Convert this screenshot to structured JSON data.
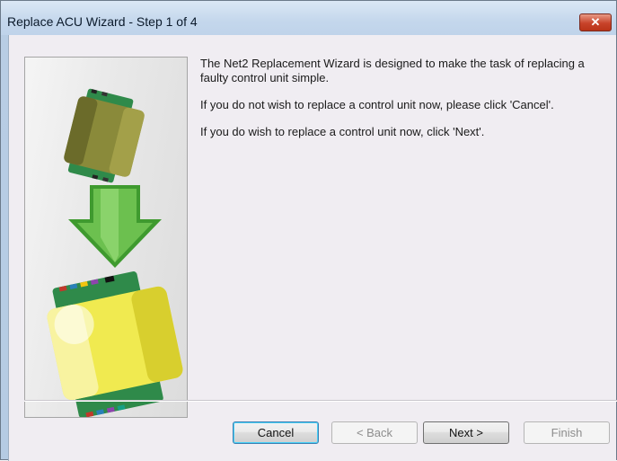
{
  "window": {
    "title": "Replace ACU Wizard - Step 1 of 4",
    "close_symbol": "✕"
  },
  "content": {
    "paragraph_1": "The Net2 Replacement Wizard is designed to make the task of replacing a faulty control unit simple.",
    "paragraph_2": "If you do not wish to replace a control unit now, please click 'Cancel'.",
    "paragraph_3": "If you do wish to replace a control unit now, click 'Next'."
  },
  "buttons": {
    "cancel": "Cancel",
    "back": "< Back",
    "next": "Next >",
    "finish": "Finish"
  },
  "colors": {
    "arrow_green": "#4aa83a",
    "unit_old": "#8a8a3a",
    "unit_new": "#f0ea50",
    "board_green": "#2f8a4a",
    "close_red": "#c8432a"
  }
}
